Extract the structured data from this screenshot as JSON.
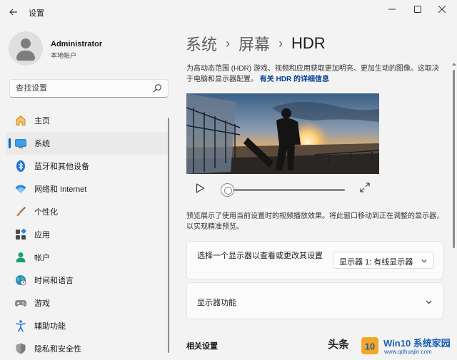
{
  "window": {
    "title": "设置"
  },
  "profile": {
    "name": "Administrator",
    "account_type": "本地帐户"
  },
  "search": {
    "placeholder": "查找设置"
  },
  "sidebar": {
    "items": [
      {
        "label": "主页",
        "icon": "home-icon"
      },
      {
        "label": "系统",
        "icon": "system-icon",
        "active": true
      },
      {
        "label": "蓝牙和其他设备",
        "icon": "bluetooth-icon"
      },
      {
        "label": "网络和 Internet",
        "icon": "wifi-icon"
      },
      {
        "label": "个性化",
        "icon": "brush-icon"
      },
      {
        "label": "应用",
        "icon": "apps-icon"
      },
      {
        "label": "帐户",
        "icon": "account-icon"
      },
      {
        "label": "时间和语言",
        "icon": "globe-icon"
      },
      {
        "label": "游戏",
        "icon": "gamepad-icon"
      },
      {
        "label": "辅助功能",
        "icon": "accessibility-icon"
      },
      {
        "label": "隐私和安全性",
        "icon": "shield-icon"
      }
    ]
  },
  "breadcrumb": {
    "level1": "系统",
    "level2": "屏幕",
    "current": "HDR",
    "separator": "›"
  },
  "hdr": {
    "description": "为高动态范围 (HDR) 游戏、视频和应用获取更加明亮、更加生动的图像。这取决于电脑和显示器配置。",
    "learn_more_link": "有关 HDR 的详细信息",
    "preview_note": "预览展示了使用当前设置时的视频播放效果。将此窗口移动到正在调整的显示器，以实现精准预览。",
    "playback_progress": 0
  },
  "monitor_card": {
    "label": "选择一个显示器以查看或更改其设置",
    "selected": "显示器 1: 有线显示器"
  },
  "caps_card": {
    "label": "显示器功能"
  },
  "related": {
    "heading": "相关设置"
  },
  "watermark": {
    "text": "头条",
    "logo_text": "10",
    "brand": "Win10 系统家园",
    "url": "www.qdhuajin.com"
  },
  "colors": {
    "accent": "#0067c0",
    "link": "#003e92",
    "background": "#f3f3f3",
    "card": "#fbfbfb"
  }
}
